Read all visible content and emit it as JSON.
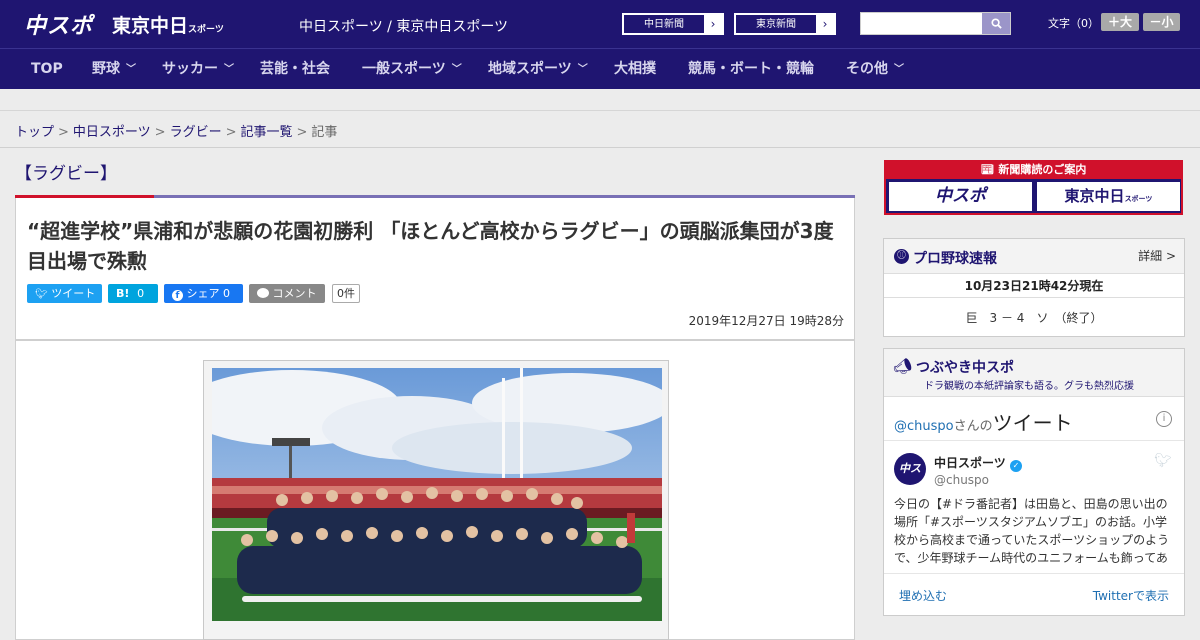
{
  "header": {
    "logo_chuspo": "中スポ",
    "logo_tokyo": "東京中日",
    "logo_tokyo_small": "スポーツ",
    "site_name": "中日スポーツ / 東京中日スポーツ",
    "btn_chunichi": "中日新聞",
    "btn_tokyo": "東京新聞",
    "search_placeholder": "",
    "fontsize_label": "文字（0）",
    "fontsize_up": "＋大",
    "fontsize_down": "－小"
  },
  "nav": {
    "items": [
      {
        "label": "TOP",
        "dropdown": false
      },
      {
        "label": "野球",
        "dropdown": true
      },
      {
        "label": "サッカー",
        "dropdown": true
      },
      {
        "label": "芸能・社会",
        "dropdown": false
      },
      {
        "label": "一般スポーツ",
        "dropdown": true
      },
      {
        "label": "地域スポーツ",
        "dropdown": true
      },
      {
        "label": "大相撲",
        "dropdown": false
      },
      {
        "label": "競馬・ボート・競輪",
        "dropdown": false
      },
      {
        "label": "その他",
        "dropdown": true
      }
    ]
  },
  "breadcrumb": {
    "items": [
      "トップ",
      "中日スポーツ",
      "ラグビー",
      "記事一覧",
      "記事"
    ],
    "separator": ">"
  },
  "article": {
    "category": "【ラグビー】",
    "title": "“超進学校”県浦和が悲願の花園初勝利 「ほとんど高校からラグビー」の頭脳派集団が3度目出場で殊勲",
    "share": {
      "tweet": "ツイート",
      "hatena": "B!",
      "hatena_count": "0",
      "facebook": "シェア",
      "facebook_count": "0",
      "comment": "コメント",
      "comment_count": "0件"
    },
    "date": "2019年12月27日 19時28分"
  },
  "sidebar": {
    "subscribe": {
      "heading": "新聞購読のご案内",
      "btn1": "中スポ",
      "btn2": "東京中日",
      "btn2_small": "スポーツ"
    },
    "baseball": {
      "title": "プロ野球速報",
      "detail": "詳細 >",
      "updated": "10月23日21時42分現在",
      "score": "巨　3 － 4　ソ　（終了）"
    },
    "tsubuyaki": {
      "title": "つぶやき中スポ",
      "subtitle": "ドラ観戦の本紙評論家も語る。グラも熱烈応援",
      "handle_prefix": "@chuspo",
      "handle_suffix": "さんの",
      "tweets_label": "ツイート",
      "account_name": "中日スポーツ",
      "account_handle": "@chuspo",
      "tweet_text": "今日の【#ドラ番記者】は田島と、田島の思い出の場所「#スポーツスタジアムソブエ」のお話。小学校から高校まで通っていたスポーツショップのようで、少年野球チーム時代のユニフォームも飾ってあ",
      "embed": "埋め込む",
      "view_on_twitter": "Twitterで表示"
    }
  },
  "colors": {
    "brand": "#1f1571",
    "accent_red": "#d0112b",
    "twitter": "#1da1f2",
    "hatena": "#00a4de",
    "facebook": "#1877f2",
    "comment": "#888888"
  }
}
